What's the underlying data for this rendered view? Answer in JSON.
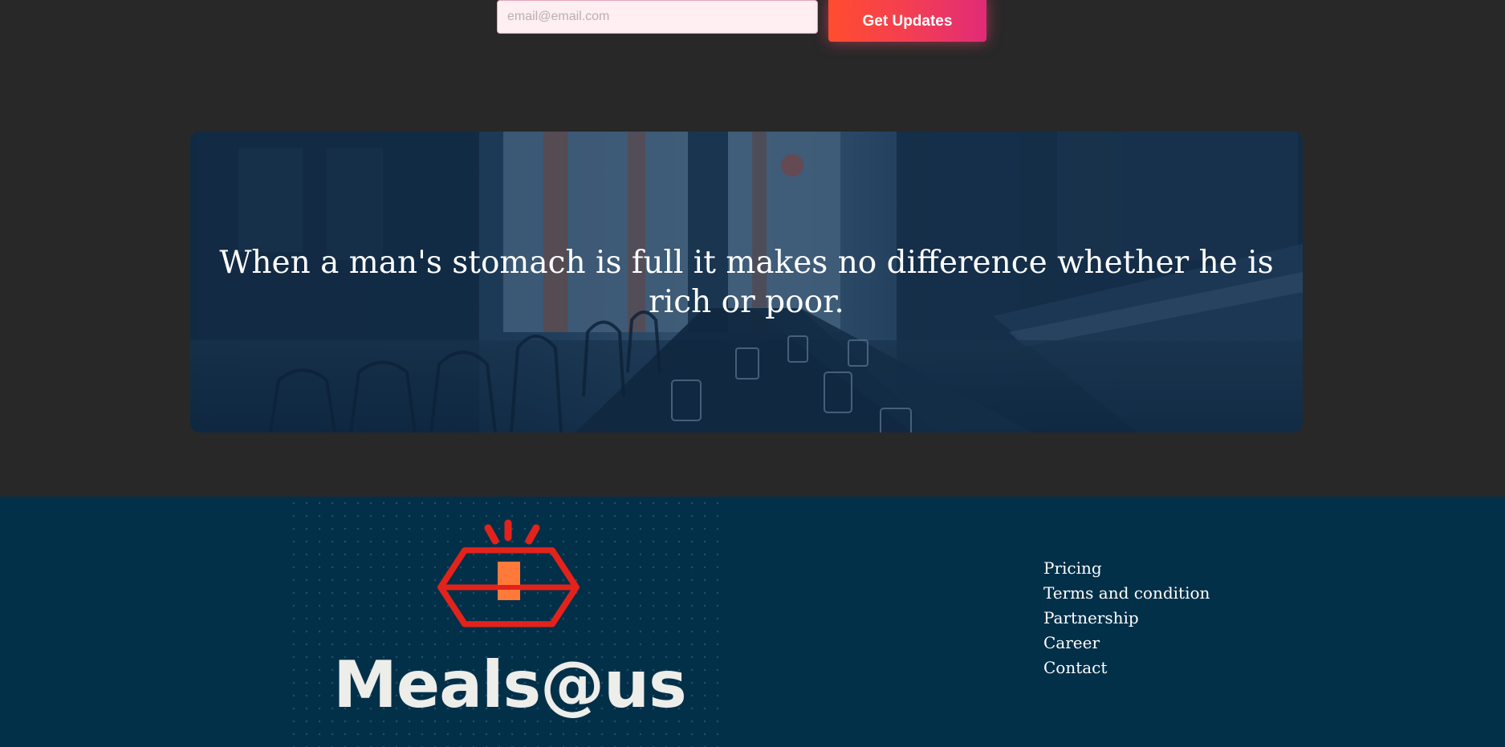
{
  "subscribe": {
    "email_placeholder": "email@email.com",
    "button_label": "Get Updates"
  },
  "banner": {
    "quote": "When a man's stomach is full it makes no difference whether he is rich or poor."
  },
  "footer": {
    "brand": "Meals@us",
    "links": [
      {
        "label": "Pricing"
      },
      {
        "label": "Terms and condition"
      },
      {
        "label": "Partnership"
      },
      {
        "label": "Career"
      },
      {
        "label": "Contact"
      }
    ]
  },
  "colors": {
    "page_background": "#282828",
    "footer_background": "#033049",
    "button_gradient_start": "#ff4d2e",
    "button_gradient_end": "#e02b78",
    "logo_red": "#e3231b",
    "logo_orange": "#ff7a3a",
    "logo_text": "#ededea"
  }
}
